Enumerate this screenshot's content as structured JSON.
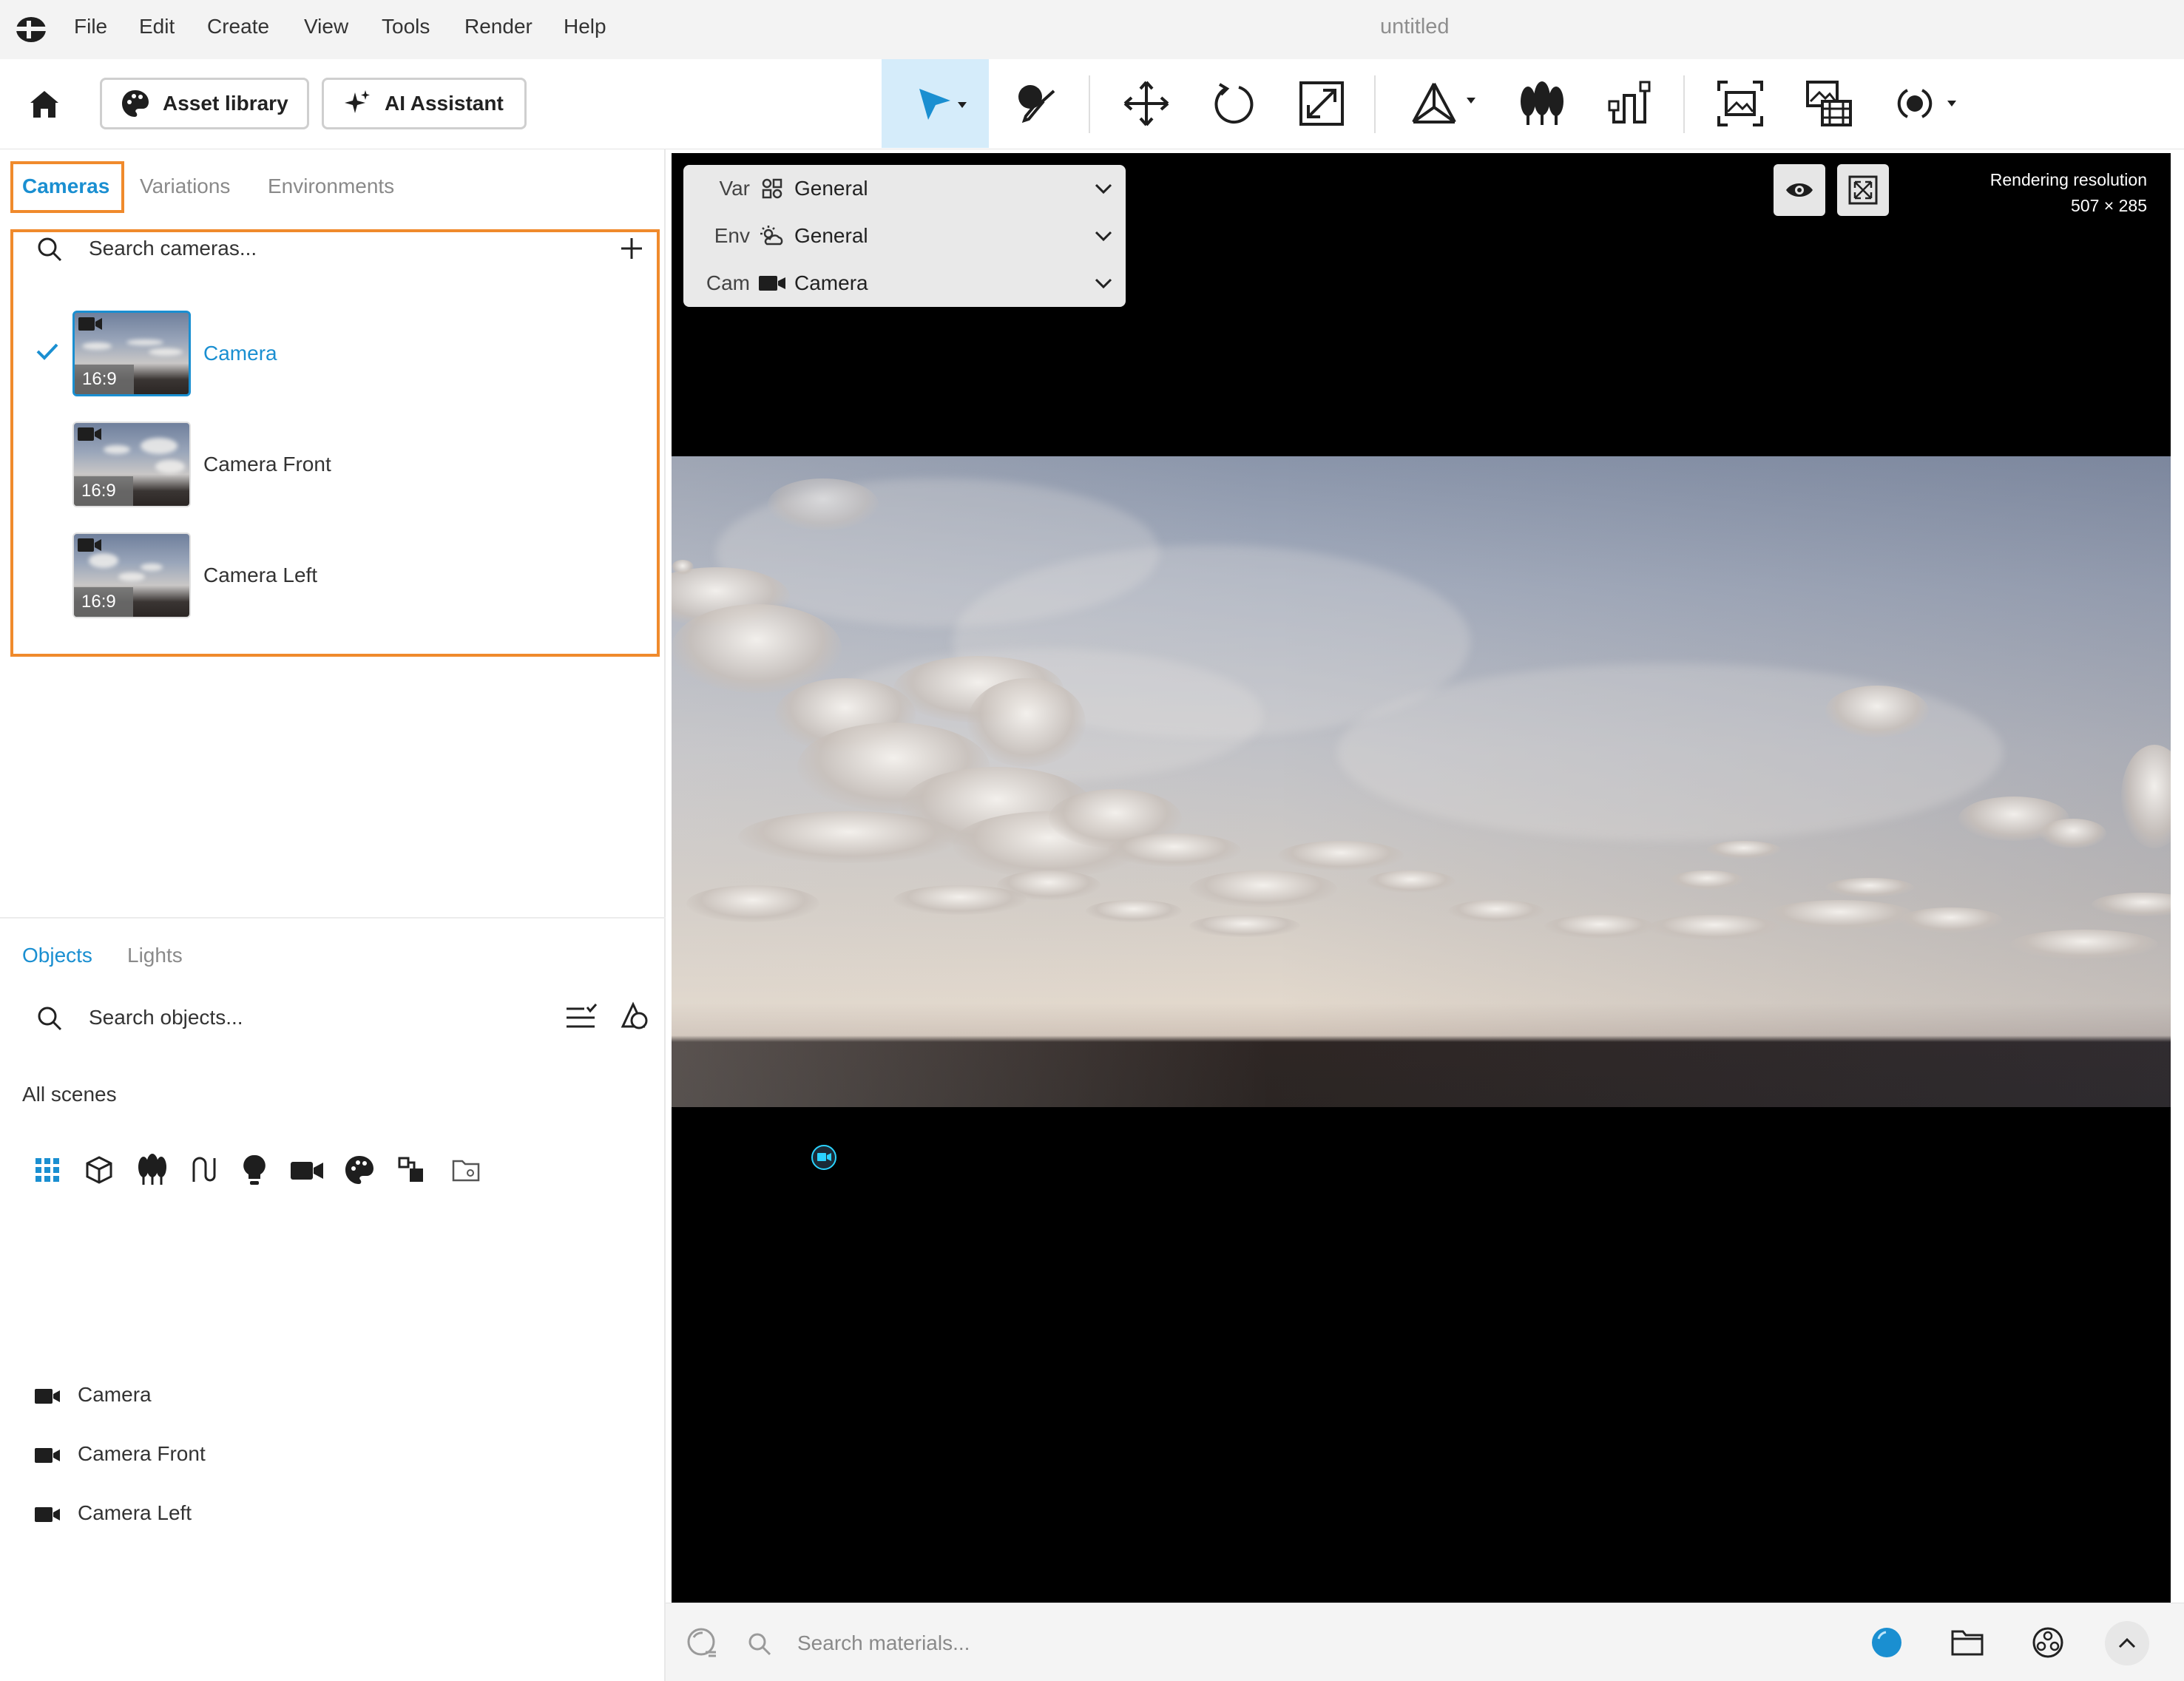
{
  "window": {
    "title": "untitled"
  },
  "menu": [
    "File",
    "Edit",
    "Create",
    "View",
    "Tools",
    "Render",
    "Help"
  ],
  "toolbar": {
    "asset_library_label": "Asset library",
    "ai_assistant_label": "AI Assistant",
    "tools": [
      "select-tool",
      "eyedropper-tool",
      "move-tool",
      "rotate-tool",
      "scale-tool",
      "pivot-tool",
      "scatter-tool",
      "constraint-tool",
      "render-region-tool",
      "render-queue-tool",
      "record-tool"
    ],
    "active_tool": "select-tool",
    "active_color": "#d5ecfa",
    "accent": "#1a8fd1"
  },
  "cameras_panel": {
    "tabs": [
      "Cameras",
      "Variations",
      "Environments"
    ],
    "active_tab": "Cameras",
    "search_placeholder": "Search cameras...",
    "items": [
      {
        "label": "Camera",
        "ratio": "16:9",
        "selected": true
      },
      {
        "label": "Camera Front",
        "ratio": "16:9",
        "selected": false
      },
      {
        "label": "Camera Left",
        "ratio": "16:9",
        "selected": false
      }
    ],
    "highlight_color": "#f08a2c"
  },
  "objects_panel": {
    "tabs": [
      "Objects",
      "Lights"
    ],
    "active_tab": "Objects",
    "search_placeholder": "Search objects...",
    "scope_label": "All scenes",
    "filter_icons": [
      "grid-icon",
      "cube-icon",
      "plants-icon",
      "curve-icon",
      "light-bulb-icon",
      "camera-icon",
      "palette-icon",
      "instances-icon",
      "folder-icon"
    ],
    "items": [
      {
        "label": "Camera"
      },
      {
        "label": "Camera Front"
      },
      {
        "label": "Camera Left"
      }
    ]
  },
  "viewport": {
    "variation_key": "Var",
    "variation_value": "General",
    "environment_key": "Env",
    "environment_value": "General",
    "camera_key": "Cam",
    "camera_value": "Camera",
    "rendering_resolution_label": "Rendering resolution",
    "rendering_resolution_value": "507 × 285"
  },
  "bottom_bar": {
    "search_placeholder": "Search materials..."
  }
}
